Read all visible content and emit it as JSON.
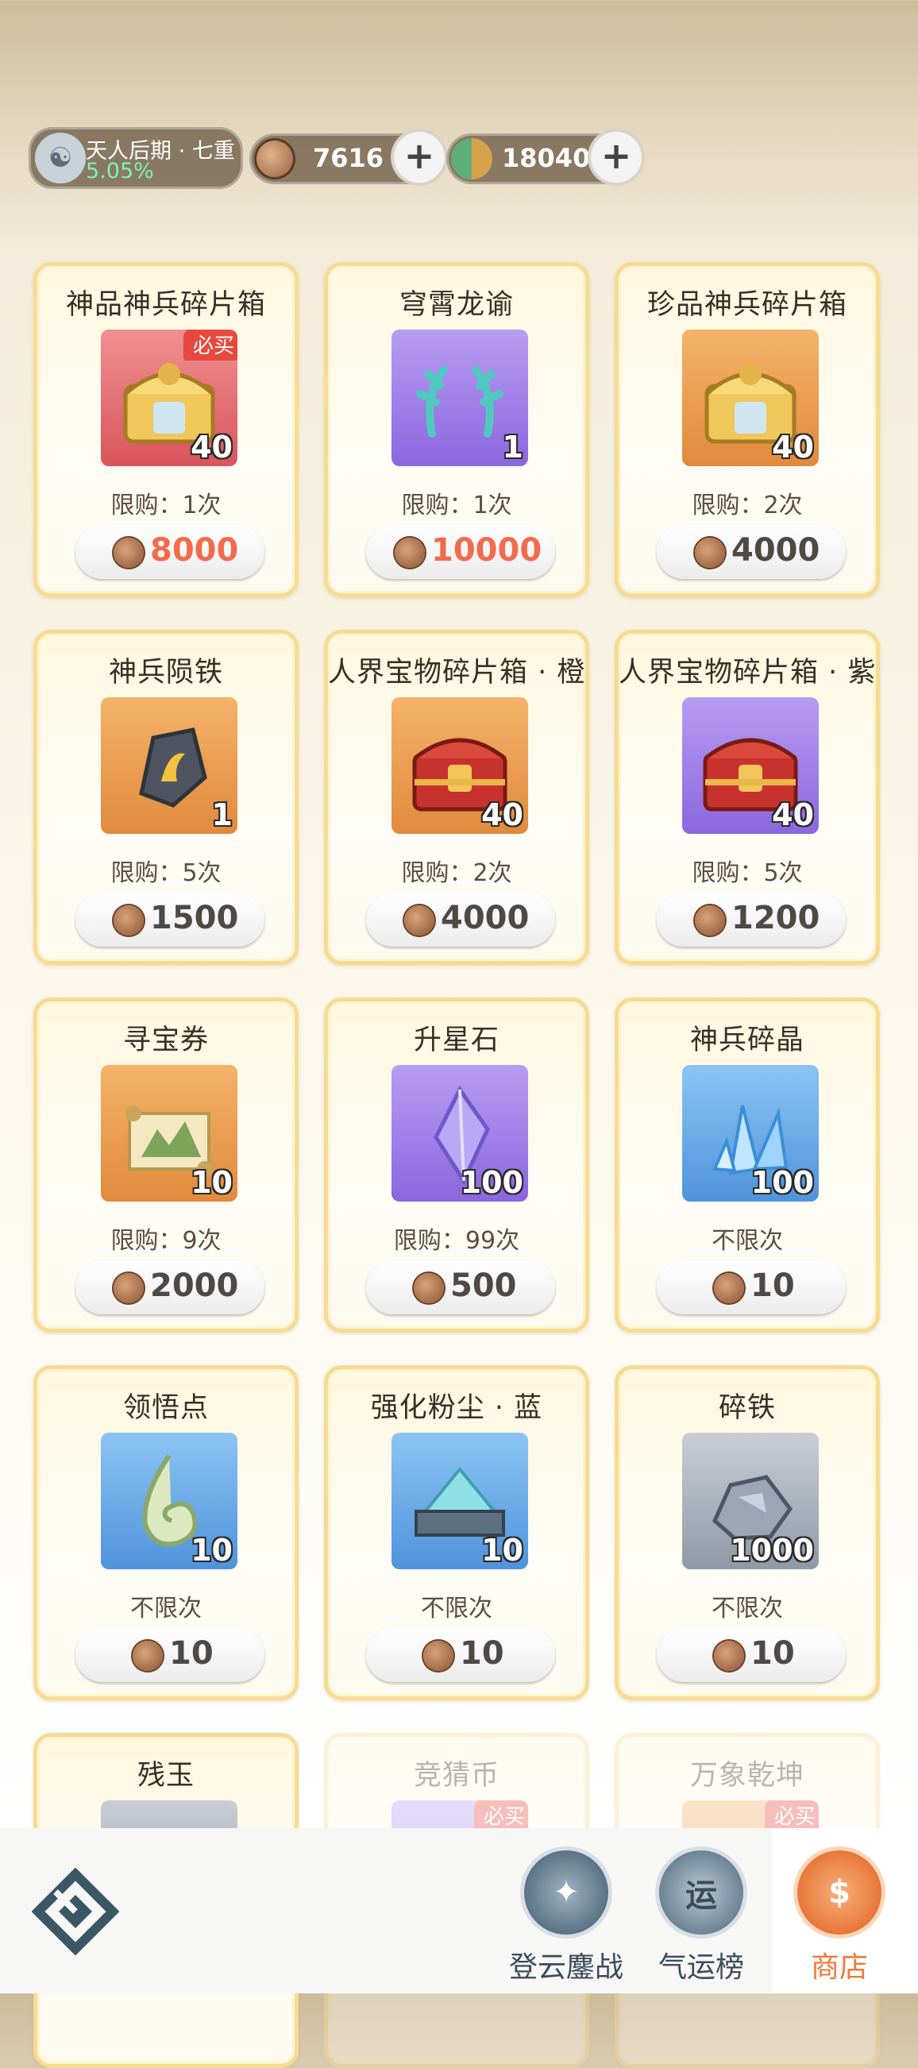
{
  "header": {
    "realm_name": "天人后期 · 七重",
    "realm_progress": "5.05%",
    "currency_1": {
      "value": "7616",
      "icon": "bronze-coin-icon"
    },
    "currency_2": {
      "value": "18040",
      "icon": "jade-qi-icon"
    },
    "plus_label": "+"
  },
  "shop": {
    "items": [
      {
        "name": "神品神兵碎片箱",
        "qty": "40",
        "badge": "必买",
        "limit": "限购：1次",
        "price": "8000",
        "price_highlight": true,
        "icon": "gold-dragon-chest-icon",
        "bg": "red"
      },
      {
        "name": "穹霄龙谕",
        "qty": "1",
        "badge": "",
        "limit": "限购：1次",
        "price": "10000",
        "price_highlight": true,
        "icon": "dragon-horns-icon",
        "bg": "purple"
      },
      {
        "name": "珍品神兵碎片箱",
        "qty": "40",
        "badge": "",
        "limit": "限购：2次",
        "price": "4000",
        "price_highlight": false,
        "icon": "gold-dragon-chest-icon",
        "bg": "orange"
      },
      {
        "name": "神兵陨铁",
        "qty": "1",
        "badge": "",
        "limit": "限购：5次",
        "price": "1500",
        "price_highlight": false,
        "icon": "meteor-iron-icon",
        "bg": "orange"
      },
      {
        "name": "人界宝物碎片箱 · 橙",
        "qty": "40",
        "badge": "",
        "limit": "限购：2次",
        "price": "4000",
        "price_highlight": false,
        "icon": "red-treasure-chest-icon",
        "bg": "orange"
      },
      {
        "name": "人界宝物碎片箱 · 紫",
        "qty": "40",
        "badge": "",
        "limit": "限购：5次",
        "price": "1200",
        "price_highlight": false,
        "icon": "red-treasure-chest-icon",
        "bg": "purple"
      },
      {
        "name": "寻宝券",
        "qty": "10",
        "badge": "",
        "limit": "限购：9次",
        "price": "2000",
        "price_highlight": false,
        "icon": "scroll-map-icon",
        "bg": "orange"
      },
      {
        "name": "升星石",
        "qty": "100",
        "badge": "",
        "limit": "限购：99次",
        "price": "500",
        "price_highlight": false,
        "icon": "star-crystal-icon",
        "bg": "purple"
      },
      {
        "name": "神兵碎晶",
        "qty": "100",
        "badge": "",
        "limit": "不限次",
        "price": "10",
        "price_highlight": false,
        "icon": "blue-crystal-shards-icon",
        "bg": "blue"
      },
      {
        "name": "领悟点",
        "qty": "10",
        "badge": "",
        "limit": "不限次",
        "price": "10",
        "price_highlight": false,
        "icon": "jade-swirl-icon",
        "bg": "blue"
      },
      {
        "name": "强化粉尘 · 蓝",
        "qty": "10",
        "badge": "",
        "limit": "不限次",
        "price": "10",
        "price_highlight": false,
        "icon": "powder-tray-icon",
        "bg": "blue"
      },
      {
        "name": "碎铁",
        "qty": "1000",
        "badge": "",
        "limit": "不限次",
        "price": "10",
        "price_highlight": false,
        "icon": "iron-ore-icon",
        "bg": "gray"
      },
      {
        "name": "残玉",
        "qty": "",
        "badge": "",
        "limit": "",
        "price": "",
        "price_highlight": false,
        "icon": "jade-fragment-icon",
        "bg": "gray"
      },
      {
        "name": "竞猜币",
        "qty": "",
        "badge": "必买",
        "limit": "",
        "price": "",
        "price_highlight": false,
        "icon": "guess-coin-icon",
        "bg": "purple"
      },
      {
        "name": "万象乾坤",
        "qty": "",
        "badge": "必买",
        "limit": "",
        "price": "",
        "price_highlight": false,
        "icon": "universe-box-icon",
        "bg": "orange"
      }
    ]
  },
  "nav": {
    "items": [
      {
        "label": "登云鏖战",
        "icon": "trophy-badge-icon",
        "active": false
      },
      {
        "label": "气运榜",
        "icon": "fortune-scroll-icon",
        "icon_text": "运",
        "active": false
      },
      {
        "label": "商店",
        "icon": "shop-bag-icon",
        "active": true
      }
    ],
    "active_color": "#f07a3a",
    "inactive_color": "#3c4c5c"
  }
}
